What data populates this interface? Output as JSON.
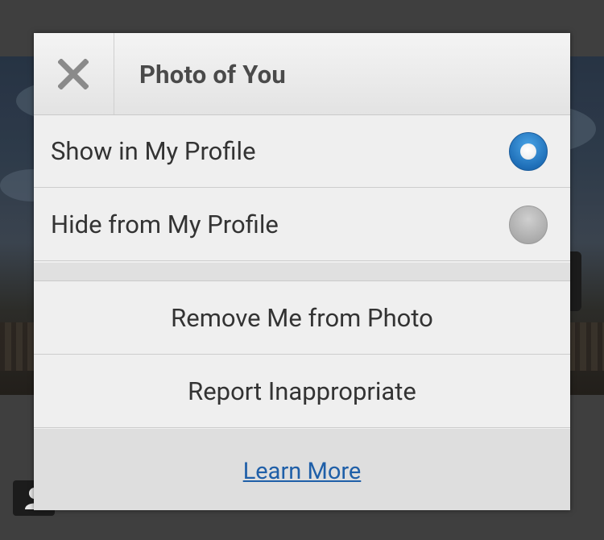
{
  "dialog": {
    "title": "Photo of You",
    "close_icon": "close-icon",
    "options": [
      {
        "label": "Show in My Profile",
        "selected": true
      },
      {
        "label": "Hide from My Profile",
        "selected": false
      }
    ],
    "actions": [
      {
        "label": "Remove Me from Photo"
      },
      {
        "label": "Report Inappropriate"
      }
    ],
    "footer_link": "Learn More"
  },
  "colors": {
    "accent": "#1f6fb8",
    "link": "#1f5fa8",
    "dialog_bg": "#efefef",
    "text": "#333333"
  }
}
